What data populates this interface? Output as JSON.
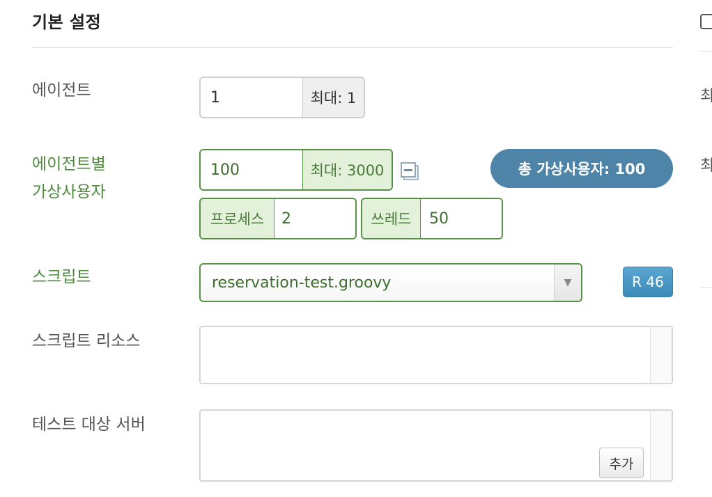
{
  "section": {
    "title": "기본 설정"
  },
  "agent": {
    "label": "에이전트",
    "value": "1",
    "max_label": "최대: 1"
  },
  "vuser": {
    "label_line1": "에이전트별",
    "label_line2": "가상사용자",
    "value": "100",
    "max_label": "최대: 3000",
    "collapse_icon": "collapse-icon",
    "total_label": "총 가상사용자: 100",
    "process_label": "프로세스",
    "process_value": "2",
    "thread_label": "쓰레드",
    "thread_value": "50"
  },
  "script": {
    "label": "스크립트",
    "selected": "reservation-test.groovy",
    "revision": "R 46"
  },
  "script_resource": {
    "label": "스크립트 리소스"
  },
  "target_server": {
    "label": "테스트 대상 서버",
    "add_label": "추가"
  },
  "right_panel": {
    "label_1": "최",
    "label_2": "최"
  },
  "colors": {
    "accent_green": "#5a8f47",
    "pill_blue": "#4d84a8",
    "badge_blue": "#3d8ab8"
  }
}
